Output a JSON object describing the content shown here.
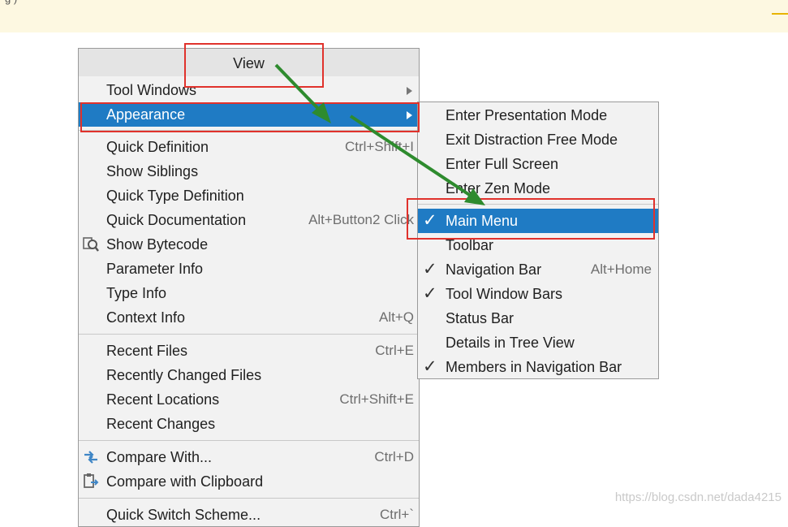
{
  "banner": {
    "cut_text": "g    )"
  },
  "menu": {
    "title": "View",
    "items": [
      {
        "label": "Tool Windows",
        "shortcut": "",
        "submenu": true
      },
      {
        "label": "Appearance",
        "shortcut": "",
        "submenu": true,
        "selected": true
      },
      {
        "label": "Quick Definition",
        "shortcut": "Ctrl+Shift+I"
      },
      {
        "label": "Show Siblings",
        "shortcut": ""
      },
      {
        "label": "Quick Type Definition",
        "shortcut": ""
      },
      {
        "label": "Quick Documentation",
        "shortcut": "Alt+Button2 Click"
      },
      {
        "label": "Show Bytecode",
        "shortcut": "",
        "icon": "bytecode-icon"
      },
      {
        "label": "Parameter Info",
        "shortcut": ""
      },
      {
        "label": "Type Info",
        "shortcut": ""
      },
      {
        "label": "Context Info",
        "shortcut": "Alt+Q"
      },
      {
        "label": "Recent Files",
        "shortcut": "Ctrl+E"
      },
      {
        "label": "Recently Changed Files",
        "shortcut": ""
      },
      {
        "label": "Recent Locations",
        "shortcut": "Ctrl+Shift+E"
      },
      {
        "label": "Recent Changes",
        "shortcut": ""
      },
      {
        "label": "Compare With...",
        "shortcut": "Ctrl+D",
        "icon": "compare-icon"
      },
      {
        "label": "Compare with Clipboard",
        "shortcut": "",
        "icon": "clipboard-compare-icon"
      },
      {
        "label": "Quick Switch Scheme...",
        "shortcut": "Ctrl+`"
      }
    ]
  },
  "submenu": {
    "items": [
      {
        "label": "Enter Presentation Mode",
        "checked": false,
        "shortcut": ""
      },
      {
        "label": "Exit Distraction Free Mode",
        "checked": false,
        "shortcut": ""
      },
      {
        "label": "Enter Full Screen",
        "checked": false,
        "shortcut": ""
      },
      {
        "label": "Enter Zen Mode",
        "checked": false,
        "shortcut": ""
      },
      {
        "label": "Main Menu",
        "checked": true,
        "selected": true,
        "shortcut": ""
      },
      {
        "label": "Toolbar",
        "checked": false,
        "shortcut": ""
      },
      {
        "label": "Navigation Bar",
        "checked": true,
        "shortcut": "Alt+Home"
      },
      {
        "label": "Tool Window Bars",
        "checked": true,
        "shortcut": ""
      },
      {
        "label": "Status Bar",
        "checked": false,
        "shortcut": ""
      },
      {
        "label": "Details in Tree View",
        "checked": false,
        "shortcut": ""
      },
      {
        "label": "Members in Navigation Bar",
        "checked": true,
        "shortcut": ""
      }
    ]
  },
  "check_glyph": "✓",
  "watermark": "https://blog.csdn.net/dada4215",
  "colors": {
    "selection": "#1f7bc4",
    "annotation_red": "#e0322c",
    "arrow_green": "#2e8b2e"
  }
}
